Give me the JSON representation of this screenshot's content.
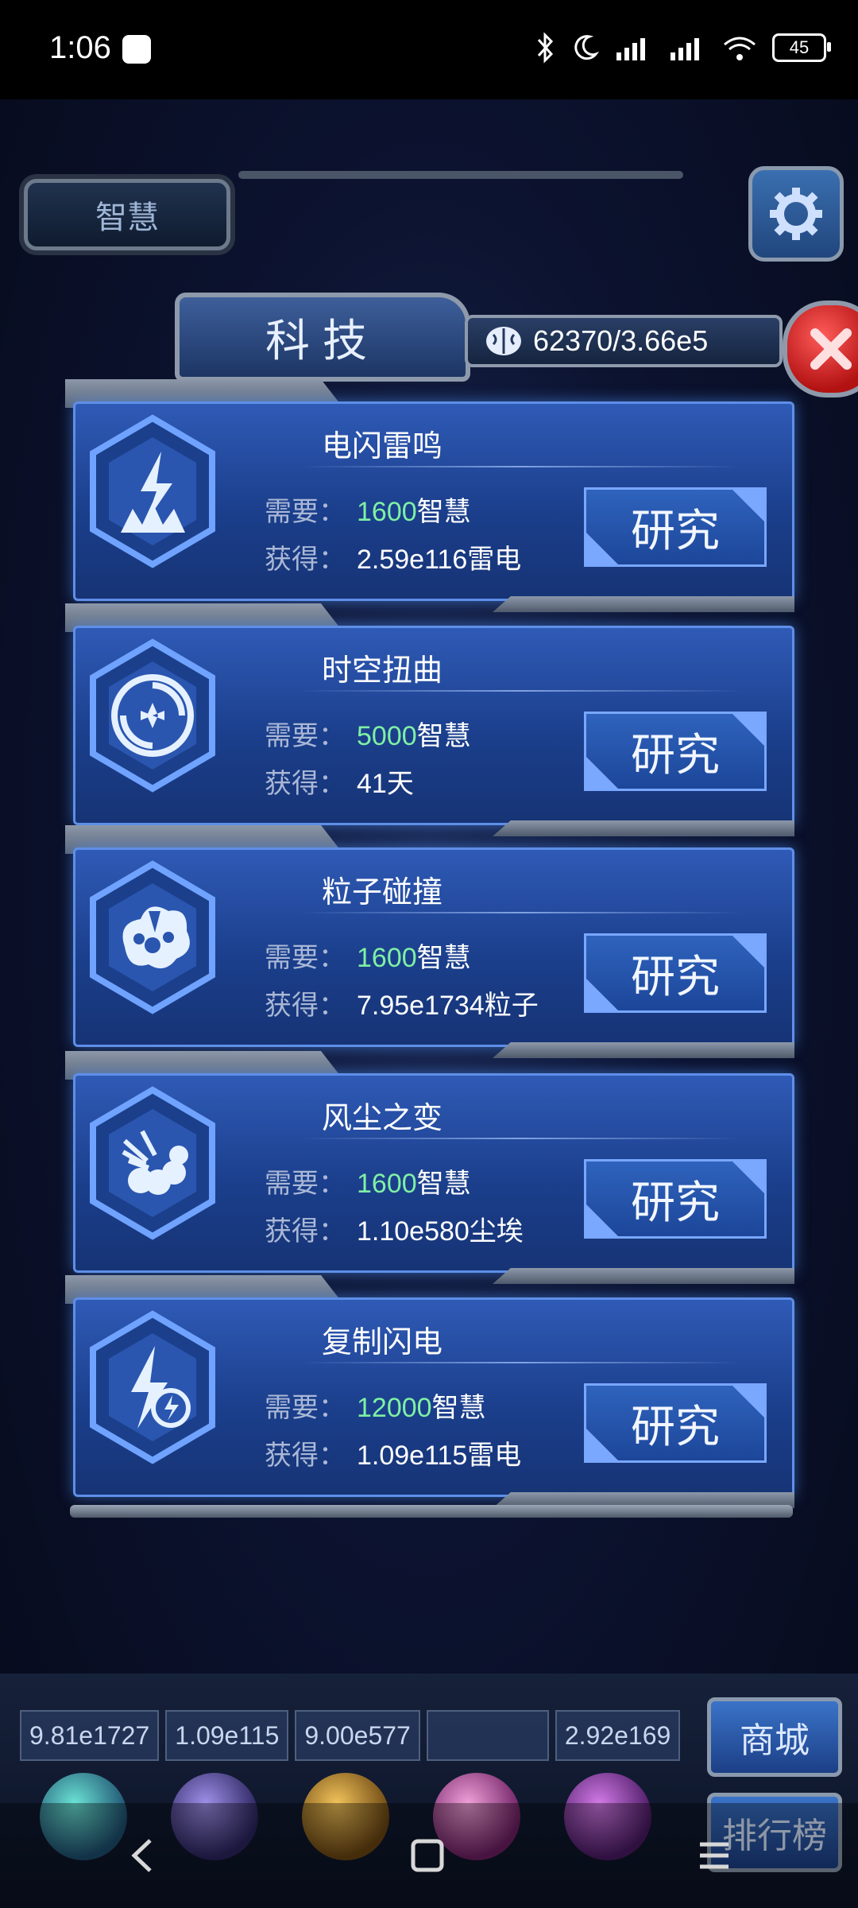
{
  "status_bar": {
    "time": "1:06",
    "battery": "45"
  },
  "top": {
    "wisdom_tab": "智慧"
  },
  "panel": {
    "title": "科技",
    "resource": "62370/3.66e5"
  },
  "labels": {
    "need": "需要：",
    "gain": "获得：",
    "unit_need": "智慧",
    "button": "研究"
  },
  "techs": [
    {
      "name": "电闪雷鸣",
      "cost": "1600",
      "gain": "2.59e116雷电",
      "icon": "lightning-burst-icon"
    },
    {
      "name": "时空扭曲",
      "cost": "5000",
      "gain": "41天",
      "icon": "vortex-icon"
    },
    {
      "name": "粒子碰撞",
      "cost": "1600",
      "gain": "7.95e1734粒子",
      "icon": "particle-collision-icon"
    },
    {
      "name": "风尘之变",
      "cost": "1600",
      "gain": "1.10e580尘埃",
      "icon": "dust-burst-icon"
    },
    {
      "name": "复制闪电",
      "cost": "12000",
      "gain": "1.09e115雷电",
      "icon": "copy-lightning-icon"
    }
  ],
  "bottom": {
    "values": [
      "9.81e1727",
      "1.09e115",
      "9.00e577",
      "",
      "2.92e169"
    ],
    "shop": "商城",
    "rank": "排行榜"
  },
  "colors": {
    "accent_green": "#7ff0a4",
    "card_blue": "#2f5ab6",
    "close_red": "#d12121"
  }
}
